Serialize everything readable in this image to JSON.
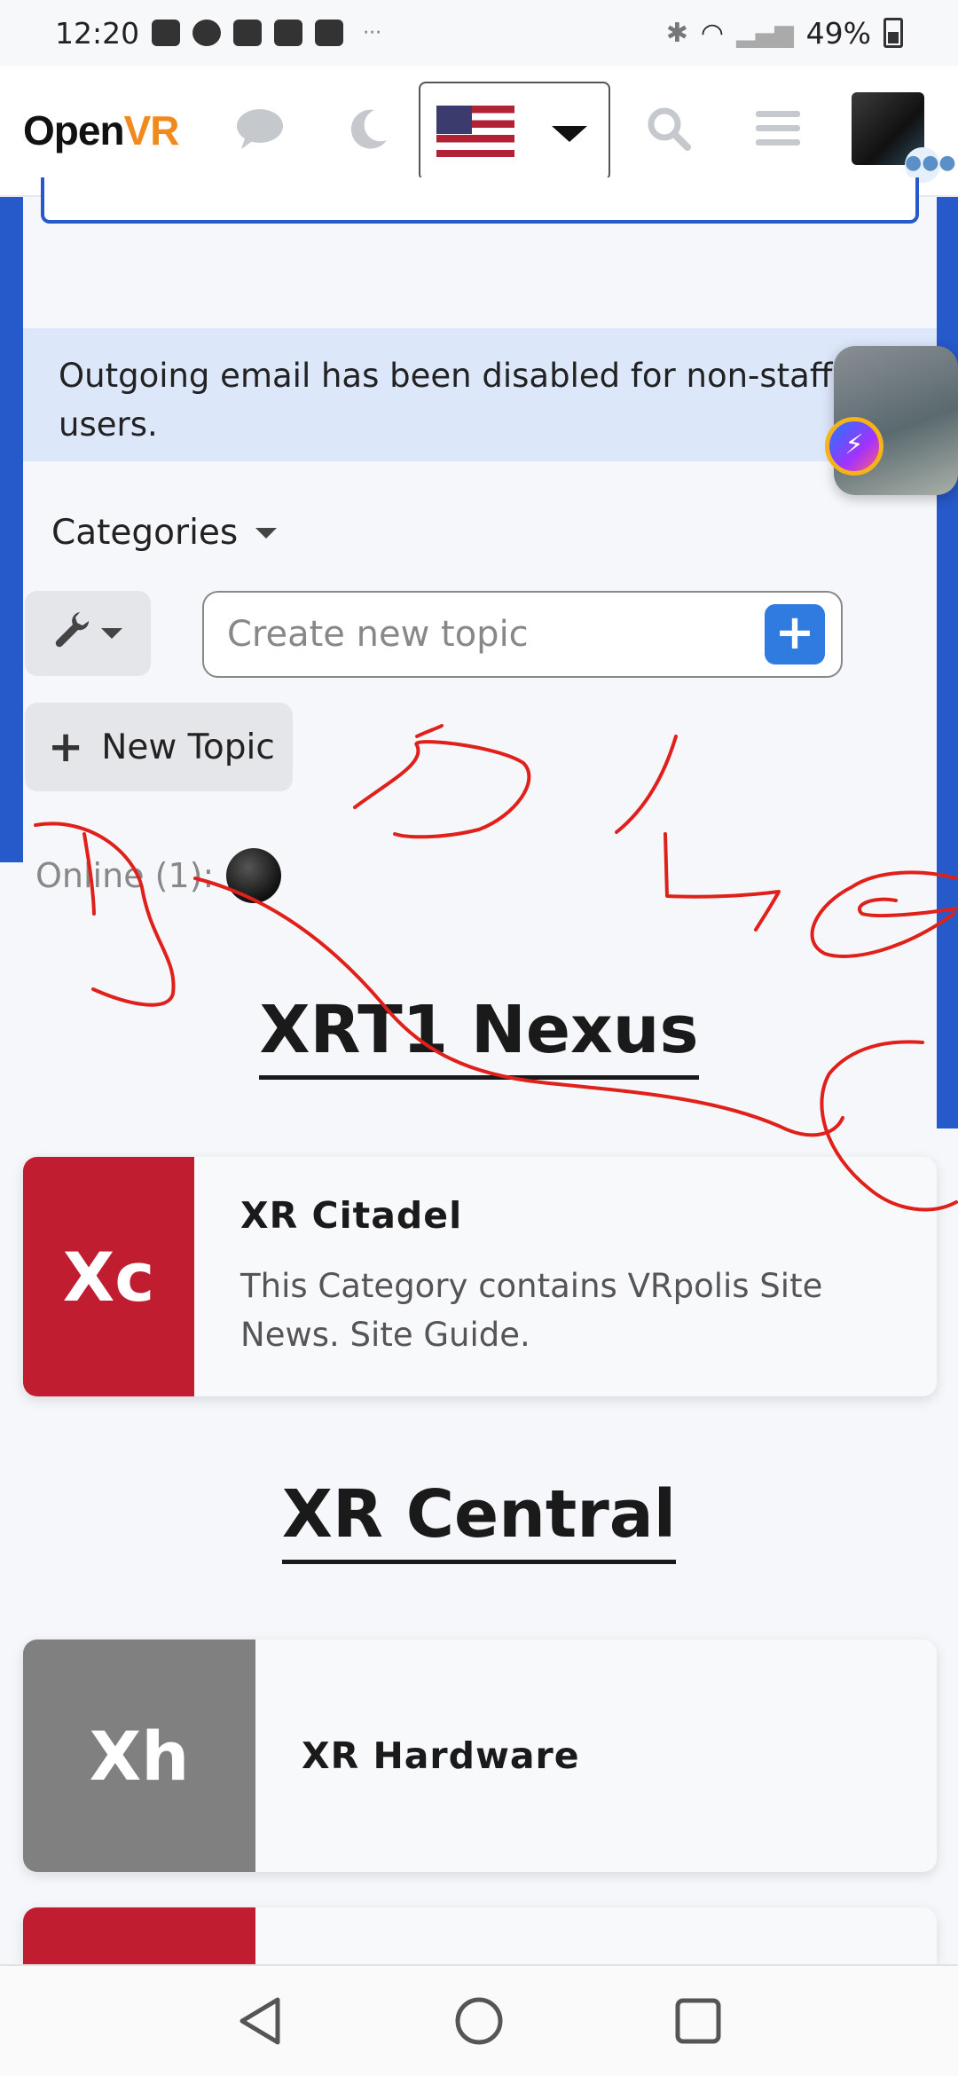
{
  "status_bar": {
    "time": "12:20",
    "more": "···",
    "battery": "49%"
  },
  "header": {
    "logo_open": "Open",
    "logo_vr": "VR",
    "language_flag": "us-flag-icon"
  },
  "notice": {
    "text": "Outgoing email has been disabled for non-staff users."
  },
  "categories_dropdown": {
    "label": "Categories"
  },
  "create_topic": {
    "placeholder": "Create new topic"
  },
  "new_topic_button": {
    "label": "New Topic"
  },
  "online": {
    "label": "Online (1):"
  },
  "sections": [
    {
      "title": "XRT1 Nexus",
      "categories": [
        {
          "badge": "Xc",
          "name": "XR Citadel",
          "description": "This Category contains VRpolis Site News. Site Guide.",
          "color": "#c01e30"
        }
      ]
    },
    {
      "title": "XR Central",
      "categories": [
        {
          "badge": "Xh",
          "name": "XR Hardware",
          "description": "",
          "color": "#808080"
        }
      ]
    }
  ],
  "colors": {
    "accent": "#2659c9",
    "notice_bg": "#dde7fa",
    "plus_button": "#2f7be0",
    "logo_vr": "#f08a1e",
    "scribble": "#e0201a"
  }
}
